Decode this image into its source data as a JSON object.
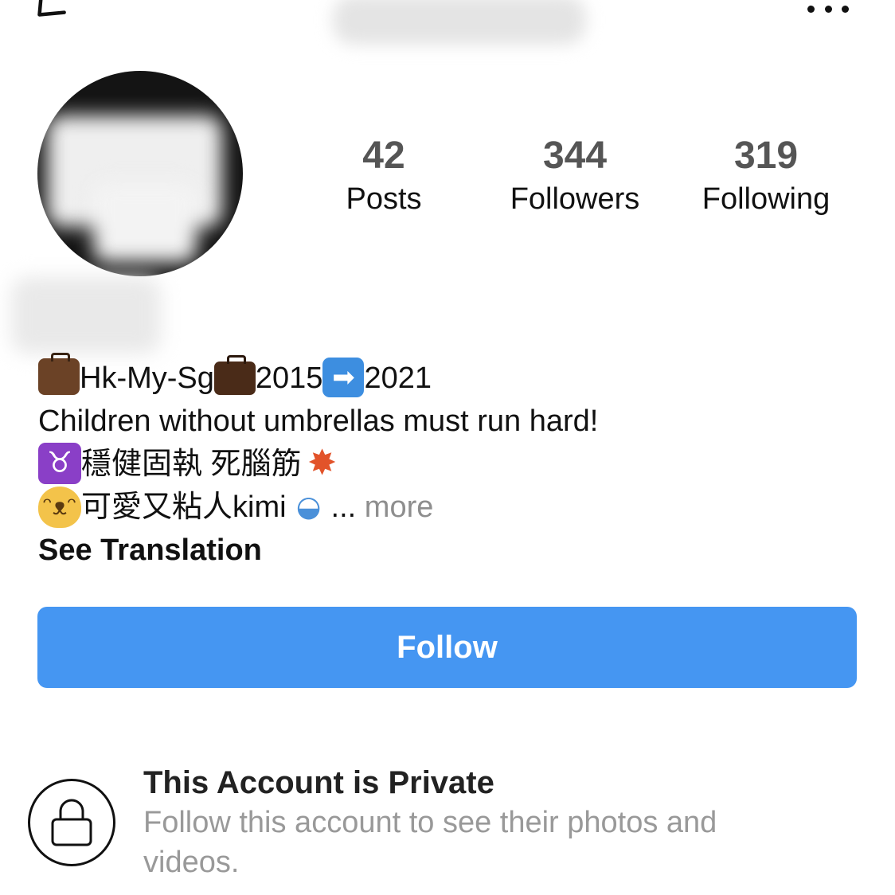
{
  "nav": {
    "back_icon": "chevron-left-icon",
    "more_icon": "more-horizontal-icon"
  },
  "stats": {
    "posts": {
      "count": "42",
      "label": "Posts"
    },
    "followers": {
      "count": "344",
      "label": "Followers"
    },
    "following": {
      "count": "319",
      "label": "Following"
    }
  },
  "bio": {
    "line1": {
      "part1": "Hk-My-Sg",
      "part2": "2015",
      "part3": "2021"
    },
    "line2": "Children without umbrellas must run hard!",
    "line3": {
      "text": "穩健固執 死腦筋"
    },
    "line4": {
      "text": "可愛又粘人kimi",
      "ellipsis": "...",
      "more": "more"
    },
    "see_translation": "See Translation"
  },
  "actions": {
    "follow_label": "Follow",
    "follow_color": "#4596f2"
  },
  "private_notice": {
    "icon": "lock-icon",
    "title": "This Account is Private",
    "description": "Follow this account to see their photos and videos."
  },
  "colors": {
    "stat_number": "#555555",
    "muted_text": "#8e8e8e"
  }
}
